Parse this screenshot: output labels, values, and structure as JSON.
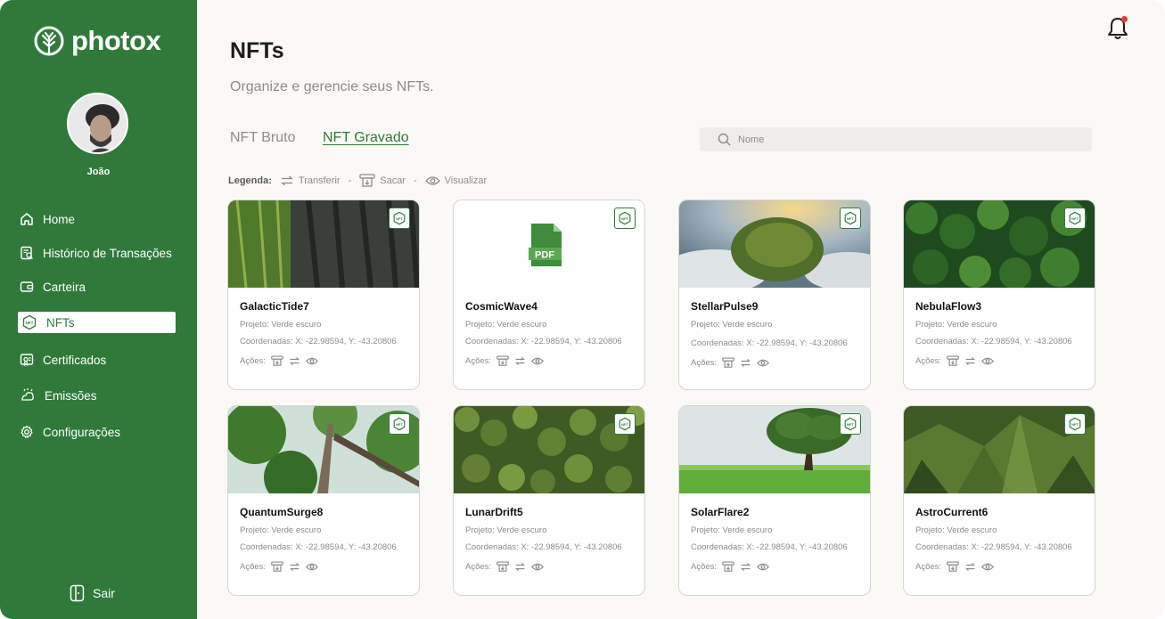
{
  "brand": {
    "name": "photox",
    "color": "#2f7a3a"
  },
  "user": {
    "name": "João"
  },
  "sidebar": {
    "items": [
      {
        "label": "Home",
        "icon": "home-icon"
      },
      {
        "label": "Histórico de Transações",
        "icon": "history-icon"
      },
      {
        "label": "Carteira",
        "icon": "wallet-icon"
      },
      {
        "label": "NFTs",
        "icon": "nft-icon",
        "active": true
      },
      {
        "label": "Certificados",
        "icon": "certificate-icon"
      },
      {
        "label": "Emissões",
        "icon": "emissions-icon"
      },
      {
        "label": "Configurações",
        "icon": "gear-icon"
      }
    ],
    "logout": "Sair"
  },
  "header": {
    "title": "NFTs",
    "subtitle": "Organize e gerencie seus NFTs.",
    "notification_dot": true
  },
  "tabs": [
    {
      "label": "NFT Bruto",
      "active": false
    },
    {
      "label": "NFT Gravado",
      "active": true
    }
  ],
  "search": {
    "placeholder": "Nome",
    "value": ""
  },
  "legend": {
    "title": "Legenda:",
    "transfer": "Transferir",
    "dash1": "-",
    "withdraw": "Sacar",
    "dash2": "-",
    "view": "Visualizar"
  },
  "badge": "NFT",
  "cards": [
    {
      "name": "GalacticTide7",
      "project": "Projeto: Verde escuro",
      "coords": "Coordenadas:  X: -22.98594, Y: -43.20806",
      "actions_label": "Ações:",
      "image": "bark-forest"
    },
    {
      "name": "CosmicWave4",
      "project": "Projeto: Verde escuro",
      "coords": "Coordenadas:  X: -22.98594, Y: -43.20806",
      "actions_label": "Ações:",
      "image": "pdf-document"
    },
    {
      "name": "StellarPulse9",
      "project": "Projeto: Verde escuro",
      "coords": "Coordenadas:  X: -22.98594, Y: -43.20806",
      "actions_label": "Ações:",
      "image": "forest-in-clouds"
    },
    {
      "name": "NebulaFlow3",
      "project": "Projeto: Verde escuro",
      "coords": "Coordenadas:  X: -22.98594, Y: -43.20806",
      "actions_label": "Ações:",
      "image": "forest-canopy"
    },
    {
      "name": "QuantumSurge8",
      "project": "Projeto: Verde escuro",
      "coords": "Coordenadas:  X: -22.98594, Y: -43.20806",
      "actions_label": "Ações:",
      "image": "tall-trees"
    },
    {
      "name": "LunarDrift5",
      "project": "Projeto: Verde escuro",
      "coords": "Coordenadas:  X: -22.98594, Y: -43.20806",
      "actions_label": "Ações:",
      "image": "aerial-forest"
    },
    {
      "name": "SolarFlare2",
      "project": "Projeto: Verde escuro",
      "coords": "Coordenadas:  X: -22.98594, Y: -43.20806",
      "actions_label": "Ações:",
      "image": "lone-tree-field"
    },
    {
      "name": "AstroCurrent6",
      "project": "Projeto: Verde escuro",
      "coords": "Coordenadas:  X: -22.98594, Y: -43.20806",
      "actions_label": "Ações:",
      "image": "mountain-forest"
    }
  ],
  "pdf_label": "PDF"
}
